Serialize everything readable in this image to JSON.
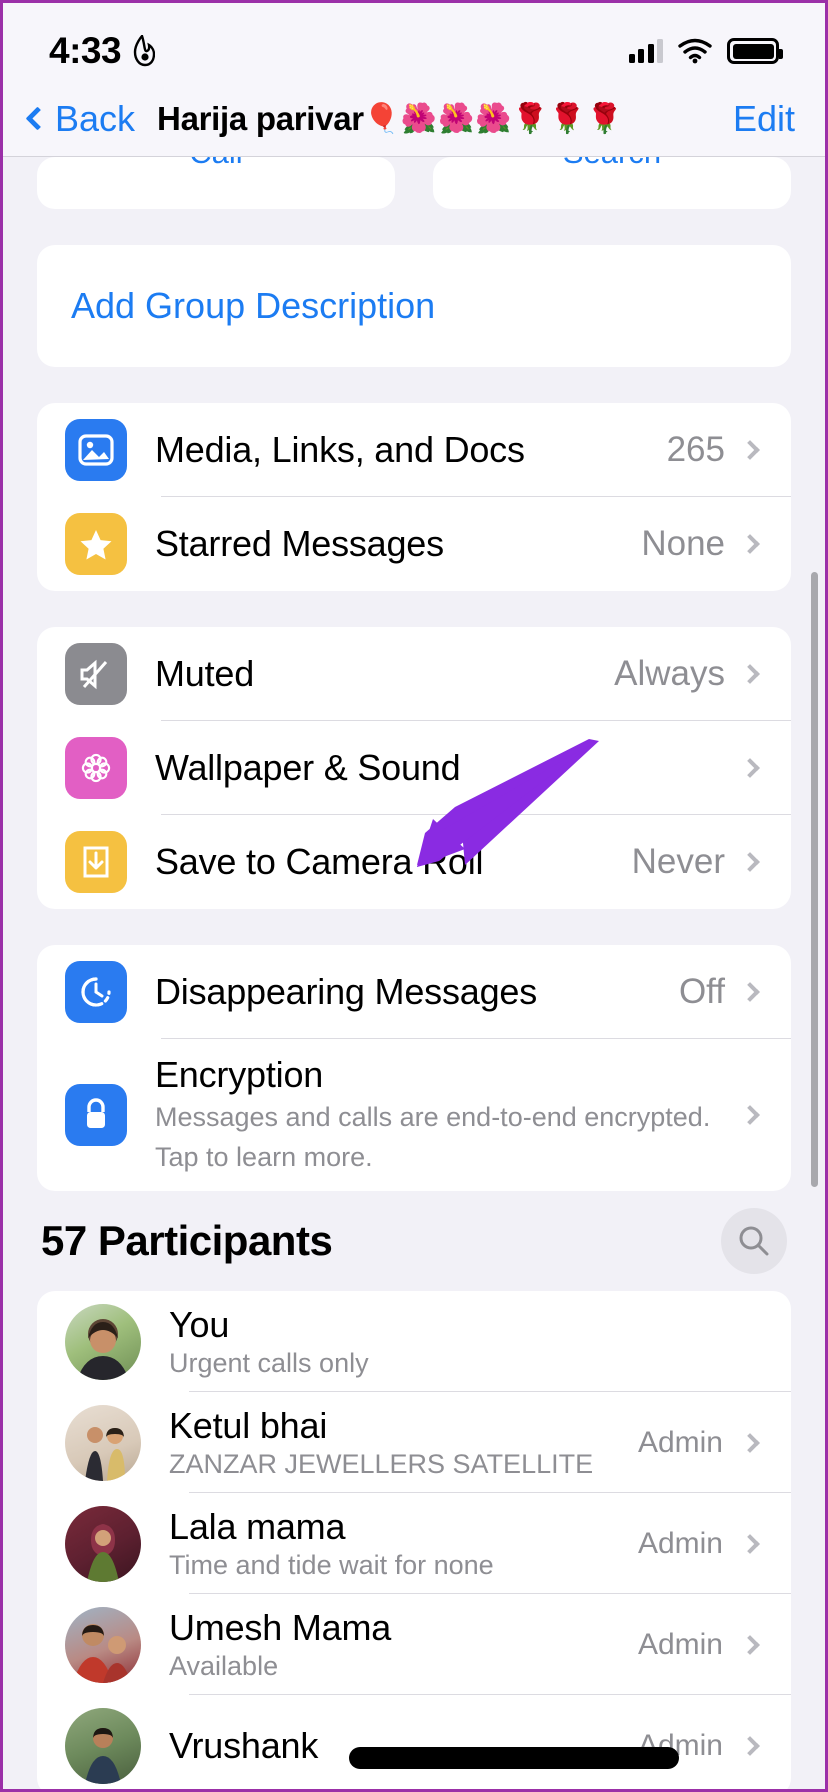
{
  "statusbar": {
    "time": "4:33",
    "flame_icon": "flame-icon",
    "signal_icon": "cellular-signal-icon",
    "wifi_icon": "wifi-icon",
    "battery_icon": "battery-full-icon"
  },
  "navbar": {
    "back_label": "Back",
    "title": "Harija parivar",
    "title_emoji": "🎈🌺🌺🌺🌹🌹🌹",
    "edit_label": "Edit"
  },
  "actions": {
    "call_label": "Call",
    "search_label": "Search"
  },
  "description": {
    "add_label": "Add Group Description"
  },
  "colors": {
    "accent_blue": "#1c7cf2",
    "media_blue": "#2a7bf0",
    "star_yellow": "#f5c141",
    "mute_gray": "#8b8b90",
    "wallpaper_pink": "#e25fc4",
    "save_yellow": "#f5c141",
    "timer_blue": "#2a7bf0",
    "lock_blue": "#2a7bf0",
    "value_gray": "#8e8e93",
    "annotation_purple": "#8a2be2"
  },
  "settings_groups": [
    {
      "rows": [
        {
          "icon": "photo-icon",
          "icon_color": "#2a7bf0",
          "label": "Media, Links, and Docs",
          "value": "265"
        },
        {
          "icon": "star-icon",
          "icon_color": "#f5c141",
          "label": "Starred Messages",
          "value": "None"
        }
      ]
    },
    {
      "rows": [
        {
          "icon": "speaker-slash-icon",
          "icon_color": "#8b8b90",
          "label": "Muted",
          "value": "Always"
        },
        {
          "icon": "flower-icon",
          "icon_color": "#e25fc4",
          "label": "Wallpaper & Sound",
          "value": ""
        },
        {
          "icon": "download-icon",
          "icon_color": "#f5c141",
          "label": "Save to Camera Roll",
          "value": "Never"
        }
      ]
    },
    {
      "rows": [
        {
          "icon": "timer-icon",
          "icon_color": "#2a7bf0",
          "label": "Disappearing Messages",
          "value": "Off"
        },
        {
          "icon": "lock-icon",
          "icon_color": "#2a7bf0",
          "label": "Encryption",
          "sub_line1": "Messages and calls are end-to-end encrypted.",
          "sub_line2": "Tap to learn more.",
          "value": ""
        }
      ]
    }
  ],
  "participants": {
    "header": "57 Participants",
    "count": 57,
    "search_icon": "search-icon",
    "items": [
      {
        "name": "You",
        "status": "Urgent calls only",
        "role": "",
        "avatar": "avatar-you",
        "redacted": false
      },
      {
        "name": "Ketul bhai",
        "status": "ZANZAR JEWELLERS SATELLITE",
        "role": "Admin",
        "avatar": "avatar-ketul",
        "redacted": false
      },
      {
        "name": "Lala mama",
        "status": "Time and tide wait for none",
        "role": "Admin",
        "avatar": "avatar-lala",
        "redacted": false
      },
      {
        "name": "Umesh Mama",
        "status": "Available",
        "role": "Admin",
        "avatar": "avatar-umesh",
        "redacted": false
      },
      {
        "name": "Vrushank",
        "status": "",
        "role": "Admin",
        "avatar": "avatar-vrushank",
        "redacted": true
      }
    ]
  },
  "annotation": {
    "type": "arrow",
    "points_to": "Save to Camera Roll",
    "color": "#8a2be2"
  }
}
